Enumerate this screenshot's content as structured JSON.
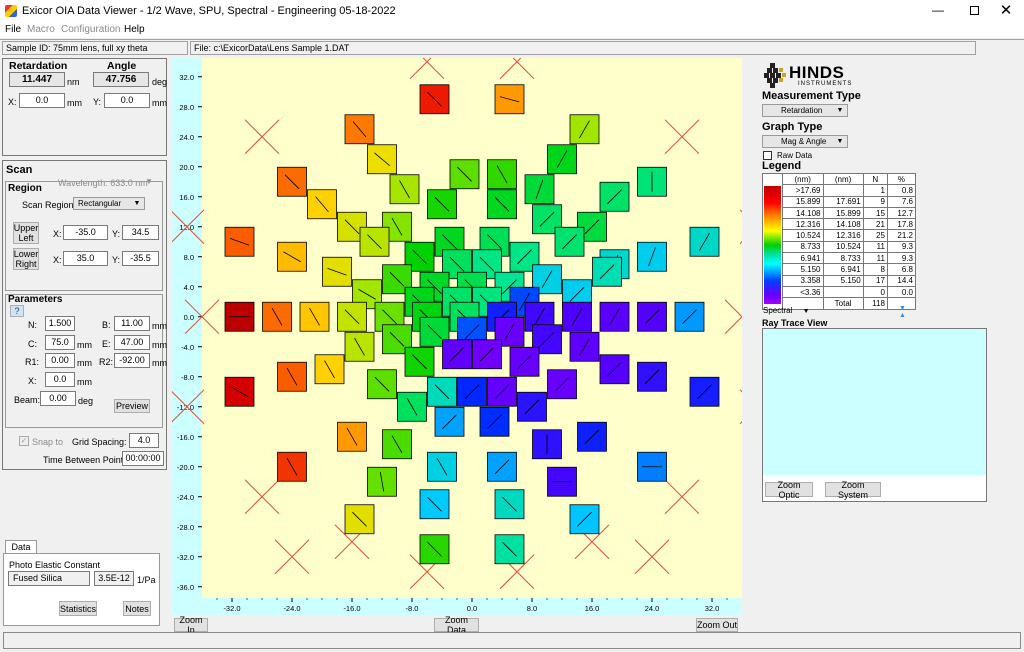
{
  "window": {
    "title": "Exicor OIA Data Viewer - 1/2 Wave, SPU, Spectral - Engineering 05-18-2022"
  },
  "menu": {
    "items": [
      "File",
      "Macro",
      "Configuration",
      "Help"
    ]
  },
  "info": {
    "sample_id": "Sample ID: 75mm lens, full xy theta",
    "file": "File: c:\\ExicorData\\Lens Sample 1.DAT"
  },
  "readout": {
    "retardation_label": "Retardation",
    "retardation_value": "11.447",
    "retardation_unit": "nm",
    "angle_label": "Angle",
    "angle_value": "47.756",
    "angle_unit": "deg",
    "x_label": "X:",
    "x_value": "0.0",
    "x_unit": "mm",
    "y_label": "Y:",
    "y_value": "0.0",
    "y_unit": "mm"
  },
  "scan": {
    "title": "Scan",
    "region_title": "Region",
    "wavelength": "Wavelength:  633.0 nm",
    "scan_region_label": "Scan Region:",
    "scan_region_value": "Rectangular",
    "upper_left_button": "Upper Left",
    "lower_right_button": "Lower Right",
    "ul_x_label": "X:",
    "ul_x": "-35.0",
    "ul_y_label": "Y:",
    "ul_y": "34.5",
    "lr_x_label": "X:",
    "lr_x": "35.0",
    "lr_y_label": "Y:",
    "lr_y": "-35.5"
  },
  "parameters": {
    "title": "Parameters",
    "help_button": "?",
    "n_label": "N:",
    "n": "1.500",
    "b_label": "B:",
    "b": "11.00",
    "b_unit": "mm",
    "c_label": "C:",
    "c": "75.0",
    "c_unit": "mm",
    "e_label": "E:",
    "e": "47.00",
    "e_unit": "mm",
    "r1_label": "R1:",
    "r1": "0.00",
    "r1_unit": "mm",
    "r2_label": "R2:",
    "r2": "-92.00",
    "r2_unit": "mm",
    "x_label": "X:",
    "x": "0.0",
    "x_unit": "mm",
    "beam_label": "Beam:",
    "beam": "0.00",
    "beam_unit": "deg",
    "preview_button": "Preview"
  },
  "grid": {
    "snap_label": "Snap to",
    "spacing_label": "Grid Spacing:",
    "spacing": "4.0",
    "time_label": "Time Between Points:",
    "time": "00:00:00"
  },
  "data_tab": {
    "tab_label": "Data",
    "constant_label": "Photo Elastic Constant",
    "material": "Fused Silica",
    "constant_value": "3.5E-12",
    "constant_unit": "1/Pa",
    "statistics_button": "Statistics",
    "notes_button": "Notes"
  },
  "plot": {
    "background": "#ffffcc",
    "axis_background": "#ccffff",
    "y_ticks": [
      "32.0",
      "28.0",
      "24.0",
      "20.0",
      "16.0",
      "12.0",
      "8.0",
      "4.0",
      "0.0",
      "-4.0",
      "-8.0",
      "-12.0",
      "-16.0",
      "-20.0",
      "-24.0",
      "-28.0",
      "-32.0",
      "-36.0"
    ],
    "x_ticks": [
      "-32.0",
      "-24.0",
      "-16.0",
      "-8.0",
      "0.0",
      "8.0",
      "16.0",
      "24.0",
      "32.0"
    ],
    "zoom_in_button": "Zoom In",
    "zoom_data_button": "Zoom Data",
    "zoom_out_button": "Zoom Out"
  },
  "logo": {
    "name": "HINDS",
    "subtitle": "INSTRUMENTS"
  },
  "measurement": {
    "title": "Measurement Type",
    "value": "Retardation"
  },
  "graph_type": {
    "title": "Graph Type",
    "value": "Mag & Angle",
    "raw_data_label": "Raw Data"
  },
  "legend": {
    "title": "Legend",
    "headers": [
      "(nm)",
      "(nm)",
      "N",
      "%"
    ],
    "rows": [
      [
        ">17.69",
        "",
        "1",
        "0.8"
      ],
      [
        "15.899",
        "17.691",
        "9",
        "7.6"
      ],
      [
        "14.108",
        "15.899",
        "15",
        "12.7"
      ],
      [
        "12.316",
        "14.108",
        "21",
        "17.8"
      ],
      [
        "10.524",
        "12.316",
        "25",
        "21.2"
      ],
      [
        "8.733",
        "10.524",
        "11",
        "9.3"
      ],
      [
        "6.941",
        "8.733",
        "11",
        "9.3"
      ],
      [
        "5.150",
        "6.941",
        "8",
        "6.8"
      ],
      [
        "3.358",
        "5.150",
        "17",
        "14.4"
      ],
      [
        "<3.36",
        "",
        "0",
        "0.0"
      ]
    ],
    "total_label": "Total",
    "total": "118",
    "palette_value": "Spectral"
  },
  "ray_trace": {
    "title": "Ray Trace View",
    "background": "#ccffff",
    "zoom_optic_button": "Zoom Optic",
    "zoom_system_button": "Zoom System"
  },
  "chart_data": {
    "type": "scatter",
    "title": "",
    "xlabel": "",
    "ylabel": "",
    "xlim": [
      -36,
      36
    ],
    "ylim": [
      -37.5,
      34.5
    ],
    "description_of_marks": "colored square per measured point, retardation magnitude mapped to color, line inside shows fast-axis angle; red X marks unmeasured points",
    "unmeasured_x": [
      [
        -6,
        34
      ],
      [
        6,
        34
      ],
      [
        -28,
        24
      ],
      [
        28,
        24
      ],
      [
        -38,
        12
      ],
      [
        38,
        12
      ],
      [
        -38,
        -12
      ],
      [
        38,
        -12
      ],
      [
        -28,
        -24
      ],
      [
        28,
        -24
      ],
      [
        -16,
        -30
      ],
      [
        16,
        -30
      ],
      [
        -6,
        -34
      ],
      [
        6,
        -34
      ],
      [
        -24,
        -32
      ],
      [
        24,
        -32
      ],
      [
        -36,
        0
      ],
      [
        36,
        0
      ]
    ],
    "points": [
      {
        "x": -5,
        "y": 29,
        "v": 17.5,
        "a": -45
      },
      {
        "x": 5,
        "y": 29,
        "v": 16.5,
        "a": -15
      },
      {
        "x": -15,
        "y": 25,
        "v": 16.8,
        "a": -50
      },
      {
        "x": 15,
        "y": 25,
        "v": 14.3,
        "a": 60
      },
      {
        "x": -12,
        "y": 21,
        "v": 15.6,
        "a": -40
      },
      {
        "x": -1,
        "y": 19,
        "v": 13.4,
        "a": -45
      },
      {
        "x": 4,
        "y": 19,
        "v": 12.9,
        "a": -60
      },
      {
        "x": 12,
        "y": 21,
        "v": 12.0,
        "a": 60
      },
      {
        "x": -24,
        "y": 18,
        "v": 16.9,
        "a": -45
      },
      {
        "x": 24,
        "y": 18,
        "v": 10.8,
        "a": 90
      },
      {
        "x": -9,
        "y": 17,
        "v": 14.4,
        "a": -60
      },
      {
        "x": 9,
        "y": 17,
        "v": 11.6,
        "a": 70
      },
      {
        "x": 19,
        "y": 16,
        "v": 11.0,
        "a": 45
      },
      {
        "x": -20,
        "y": 15,
        "v": 16.0,
        "a": -50
      },
      {
        "x": -4,
        "y": 15,
        "v": 12.6,
        "a": -45
      },
      {
        "x": 4,
        "y": 15,
        "v": 11.9,
        "a": -45
      },
      {
        "x": -16,
        "y": 12,
        "v": 15.2,
        "a": -45
      },
      {
        "x": 16,
        "y": 12,
        "v": 11.5,
        "a": 45
      },
      {
        "x": -10,
        "y": 12,
        "v": 13.9,
        "a": -60
      },
      {
        "x": 10,
        "y": 13,
        "v": 11.0,
        "a": 45
      },
      {
        "x": -3,
        "y": 10,
        "v": 11.9,
        "a": -45
      },
      {
        "x": 3,
        "y": 10,
        "v": 11.2,
        "a": -45
      },
      {
        "x": -13,
        "y": 10,
        "v": 14.7,
        "a": -45
      },
      {
        "x": 13,
        "y": 10,
        "v": 10.9,
        "a": 45
      },
      {
        "x": -31,
        "y": 10,
        "v": 17.0,
        "a": -20
      },
      {
        "x": 31,
        "y": 10,
        "v": 9.6,
        "a": 60
      },
      {
        "x": -24,
        "y": 8,
        "v": 16.2,
        "a": -30
      },
      {
        "x": 24,
        "y": 8,
        "v": 9.0,
        "a": 70
      },
      {
        "x": 19,
        "y": 7,
        "v": 9.5,
        "a": 70
      },
      {
        "x": -7,
        "y": 8,
        "v": 12.3,
        "a": -45
      },
      {
        "x": 7,
        "y": 8,
        "v": 10.6,
        "a": 45
      },
      {
        "x": -2,
        "y": 7,
        "v": 11.1,
        "a": -45
      },
      {
        "x": 2,
        "y": 7,
        "v": 10.6,
        "a": -45
      },
      {
        "x": -18,
        "y": 6,
        "v": 15.4,
        "a": -20
      },
      {
        "x": 18,
        "y": 6,
        "v": 9.9,
        "a": 45
      },
      {
        "x": -10,
        "y": 5,
        "v": 13.0,
        "a": -45
      },
      {
        "x": 10,
        "y": 5,
        "v": 9.2,
        "a": 60
      },
      {
        "x": -5,
        "y": 4,
        "v": 11.8,
        "a": -45
      },
      {
        "x": 5,
        "y": 4,
        "v": 10.4,
        "a": 45
      },
      {
        "x": 0,
        "y": 4,
        "v": 11.3,
        "a": -45
      },
      {
        "x": -14,
        "y": 3,
        "v": 14.3,
        "a": -30
      },
      {
        "x": 14,
        "y": 3,
        "v": 9.0,
        "a": 45
      },
      {
        "x": -7,
        "y": 2,
        "v": 12.0,
        "a": -45
      },
      {
        "x": 7,
        "y": 2,
        "v": 7.3,
        "a": 60
      },
      {
        "x": -2,
        "y": 2,
        "v": 11.0,
        "a": -45
      },
      {
        "x": 2,
        "y": 2,
        "v": 10.7,
        "a": -45
      },
      {
        "x": -31,
        "y": 0,
        "v": 18.0,
        "a": 0
      },
      {
        "x": -26,
        "y": 0,
        "v": 16.9,
        "a": -60
      },
      {
        "x": -21,
        "y": 0,
        "v": 16.1,
        "a": -60
      },
      {
        "x": -16,
        "y": 0,
        "v": 14.9,
        "a": -45
      },
      {
        "x": -11,
        "y": 0,
        "v": 13.6,
        "a": -45
      },
      {
        "x": -6,
        "y": 0,
        "v": 12.1,
        "a": -45
      },
      {
        "x": -1,
        "y": 0,
        "v": 11.1,
        "a": -45
      },
      {
        "x": 4,
        "y": 0,
        "v": 6.5,
        "a": 45
      },
      {
        "x": 9,
        "y": 0,
        "v": 5.5,
        "a": 60
      },
      {
        "x": 14,
        "y": 0,
        "v": 5.2,
        "a": 60
      },
      {
        "x": 19,
        "y": 0,
        "v": 4.8,
        "a": 60
      },
      {
        "x": 24,
        "y": 0,
        "v": 5.0,
        "a": 45
      },
      {
        "x": 29,
        "y": 0,
        "v": 8.2,
        "a": 45
      },
      {
        "x": -5,
        "y": -2,
        "v": 11.6,
        "a": -45
      },
      {
        "x": 5,
        "y": -2,
        "v": 4.2,
        "a": 60
      },
      {
        "x": 0,
        "y": -2,
        "v": 7.4,
        "a": 45
      },
      {
        "x": -10,
        "y": -3,
        "v": 13.2,
        "a": -45
      },
      {
        "x": 10,
        "y": -3,
        "v": 5.4,
        "a": 45
      },
      {
        "x": -2,
        "y": -5,
        "v": 4.5,
        "a": 45
      },
      {
        "x": 2,
        "y": -5,
        "v": 4.0,
        "a": 45
      },
      {
        "x": -15,
        "y": -4,
        "v": 14.7,
        "a": -60
      },
      {
        "x": 15,
        "y": -4,
        "v": 4.6,
        "a": 60
      },
      {
        "x": -7,
        "y": -6,
        "v": 12.5,
        "a": -45
      },
      {
        "x": 7,
        "y": -6,
        "v": 4.3,
        "a": 45
      },
      {
        "x": -24,
        "y": -8,
        "v": 17.0,
        "a": -60
      },
      {
        "x": 24,
        "y": -8,
        "v": 5.8,
        "a": 45
      },
      {
        "x": 19,
        "y": -7,
        "v": 4.9,
        "a": 45
      },
      {
        "x": -19,
        "y": -7,
        "v": 16.0,
        "a": -60
      },
      {
        "x": -12,
        "y": -9,
        "v": 13.4,
        "a": -45
      },
      {
        "x": 12,
        "y": -9,
        "v": 4.3,
        "a": 45
      },
      {
        "x": -4,
        "y": -10,
        "v": 9.8,
        "a": -45
      },
      {
        "x": 0,
        "y": -10,
        "v": 6.9,
        "a": 45
      },
      {
        "x": 4,
        "y": -10,
        "v": 4.4,
        "a": 45
      },
      {
        "x": -31,
        "y": -10,
        "v": 17.8,
        "a": -30
      },
      {
        "x": 31,
        "y": -10,
        "v": 6.5,
        "a": 45
      },
      {
        "x": -8,
        "y": -12,
        "v": 11.1,
        "a": -60
      },
      {
        "x": 8,
        "y": -12,
        "v": 6.0,
        "a": 45
      },
      {
        "x": -3,
        "y": -14,
        "v": 8.3,
        "a": 45
      },
      {
        "x": 3,
        "y": -14,
        "v": 7.0,
        "a": 45
      },
      {
        "x": -16,
        "y": -16,
        "v": 16.5,
        "a": -60
      },
      {
        "x": 16,
        "y": -16,
        "v": 6.6,
        "a": 45
      },
      {
        "x": -10,
        "y": -17,
        "v": 13.2,
        "a": -60
      },
      {
        "x": 10,
        "y": -17,
        "v": 5.9,
        "a": 90
      },
      {
        "x": -24,
        "y": -20,
        "v": 17.3,
        "a": -60
      },
      {
        "x": 24,
        "y": -20,
        "v": 7.9,
        "a": 0
      },
      {
        "x": -4,
        "y": -20,
        "v": 9.2,
        "a": -60
      },
      {
        "x": 4,
        "y": -20,
        "v": 8.3,
        "a": 45
      },
      {
        "x": -12,
        "y": -22,
        "v": 13.5,
        "a": -80
      },
      {
        "x": 12,
        "y": -22,
        "v": 5.4,
        "a": 0
      },
      {
        "x": -5,
        "y": -25,
        "v": 8.8,
        "a": -45
      },
      {
        "x": 5,
        "y": -25,
        "v": 9.7,
        "a": -45
      },
      {
        "x": -15,
        "y": -27,
        "v": 15.4,
        "a": -45
      },
      {
        "x": 15,
        "y": -27,
        "v": 8.7,
        "a": 45
      },
      {
        "x": -5,
        "y": -31,
        "v": 12.8,
        "a": -45
      },
      {
        "x": 5,
        "y": -31,
        "v": 10.2,
        "a": -45
      }
    ]
  }
}
